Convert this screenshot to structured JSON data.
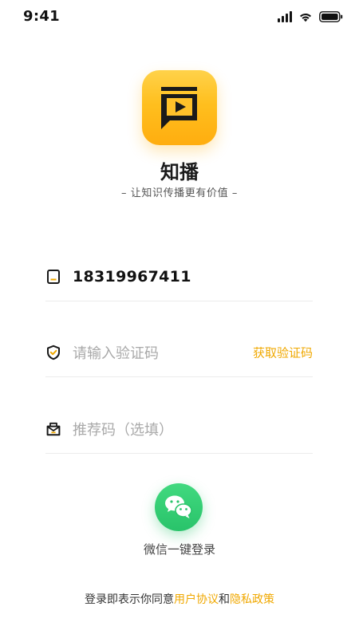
{
  "status_bar": {
    "time": "9:41",
    "icons": [
      "signal-icon",
      "wifi-icon",
      "battery-icon"
    ]
  },
  "app": {
    "name": "知播",
    "tagline": "– 让知识传播更有价值 –",
    "logo_icon": "play-screen-icon",
    "brand_color": "#FFBF1E"
  },
  "form": {
    "phone": {
      "icon": "phone-icon",
      "value": "18319967411"
    },
    "code": {
      "icon": "shield-check-icon",
      "placeholder": "请输入验证码",
      "action_label": "获取验证码"
    },
    "referral": {
      "icon": "mail-icon",
      "placeholder": "推荐码（选填）"
    }
  },
  "wechat": {
    "icon": "wechat-icon",
    "label": "微信一键登录",
    "color": "#2BC46B"
  },
  "agreement": {
    "prefix": "登录即表示你同意",
    "user_agreement": "用户协议",
    "conjunction": "和",
    "privacy_policy": "隐私政策",
    "link_color": "#F0A800"
  }
}
